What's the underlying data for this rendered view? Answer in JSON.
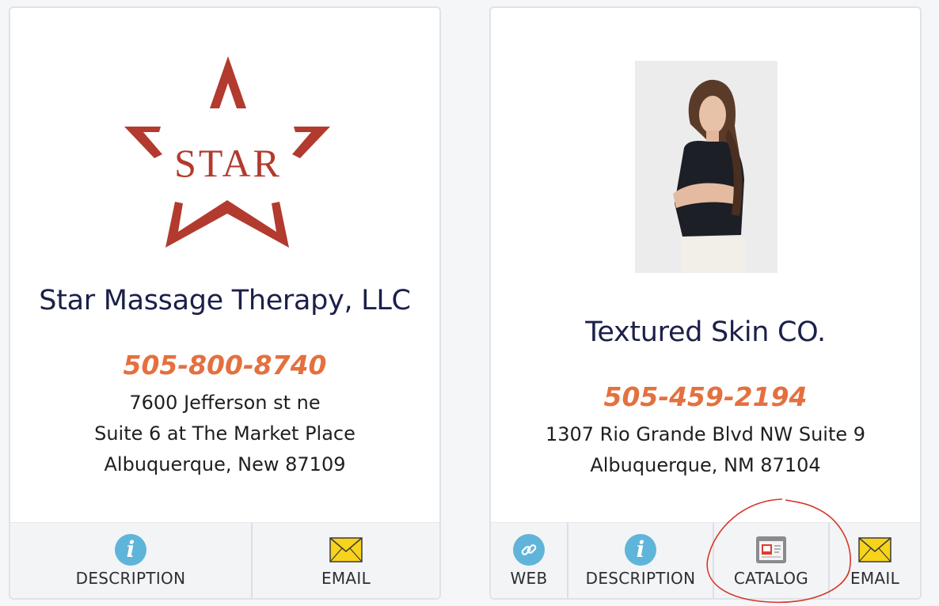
{
  "cards": [
    {
      "name": "Star Massage Therapy, LLC",
      "logo_text": "STAR",
      "phone": "505-800-8740",
      "address": [
        "7600 Jefferson st ne",
        "Suite 6 at The Market Place",
        "Albuquerque, New 87109"
      ],
      "actions": [
        {
          "label": "DESCRIPTION",
          "icon": "info-icon"
        },
        {
          "label": "EMAIL",
          "icon": "envelope-icon"
        }
      ]
    },
    {
      "name": "Textured Skin CO.",
      "photo": "portrait-photo",
      "phone": "505-459-2194",
      "address": [
        "1307 Rio Grande Blvd NW Suite 9",
        "Albuquerque, NM 87104"
      ],
      "actions": [
        {
          "label": "WEB",
          "icon": "link-icon"
        },
        {
          "label": "DESCRIPTION",
          "icon": "info-icon"
        },
        {
          "label": "CATALOG",
          "icon": "catalog-icon"
        },
        {
          "label": "EMAIL",
          "icon": "envelope-icon"
        }
      ]
    }
  ],
  "colors": {
    "name": "#1b1f4a",
    "phone": "#e4703f",
    "logo": "#b33a2e",
    "info_icon": "#5fb4d9",
    "annotation": "#d8362a"
  }
}
